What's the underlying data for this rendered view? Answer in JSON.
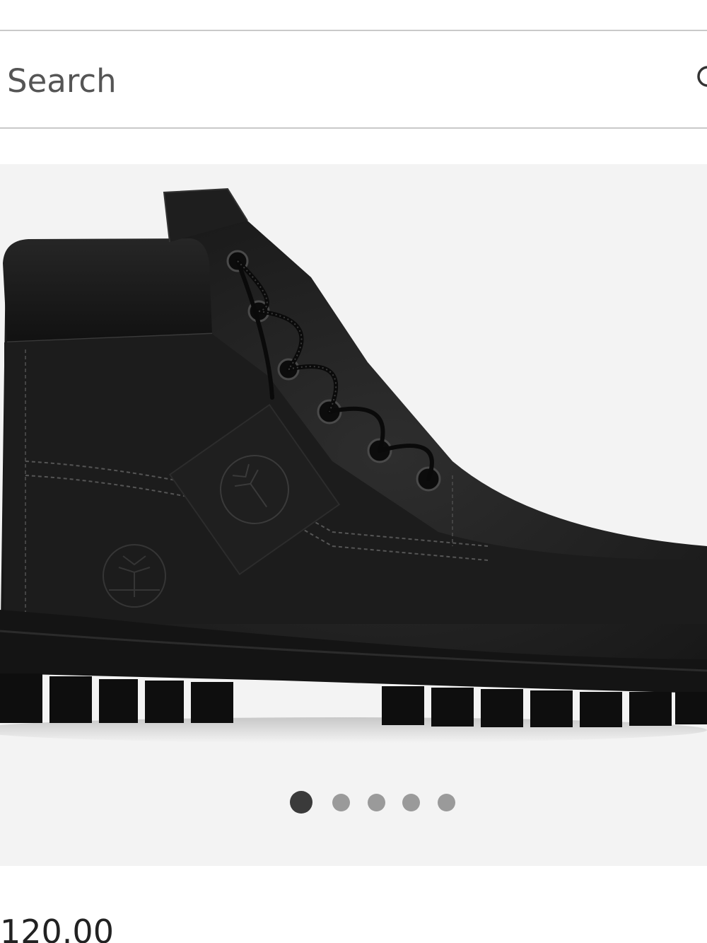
{
  "search": {
    "placeholder": "Search",
    "value": "",
    "icon": "search-icon"
  },
  "gallery": {
    "image": "black-leather-boot",
    "background_color": "#f3f3f3",
    "dots": [
      {
        "active": true
      },
      {
        "active": false
      },
      {
        "active": false
      },
      {
        "active": false
      },
      {
        "active": false
      }
    ]
  },
  "product": {
    "price": "120.00"
  }
}
